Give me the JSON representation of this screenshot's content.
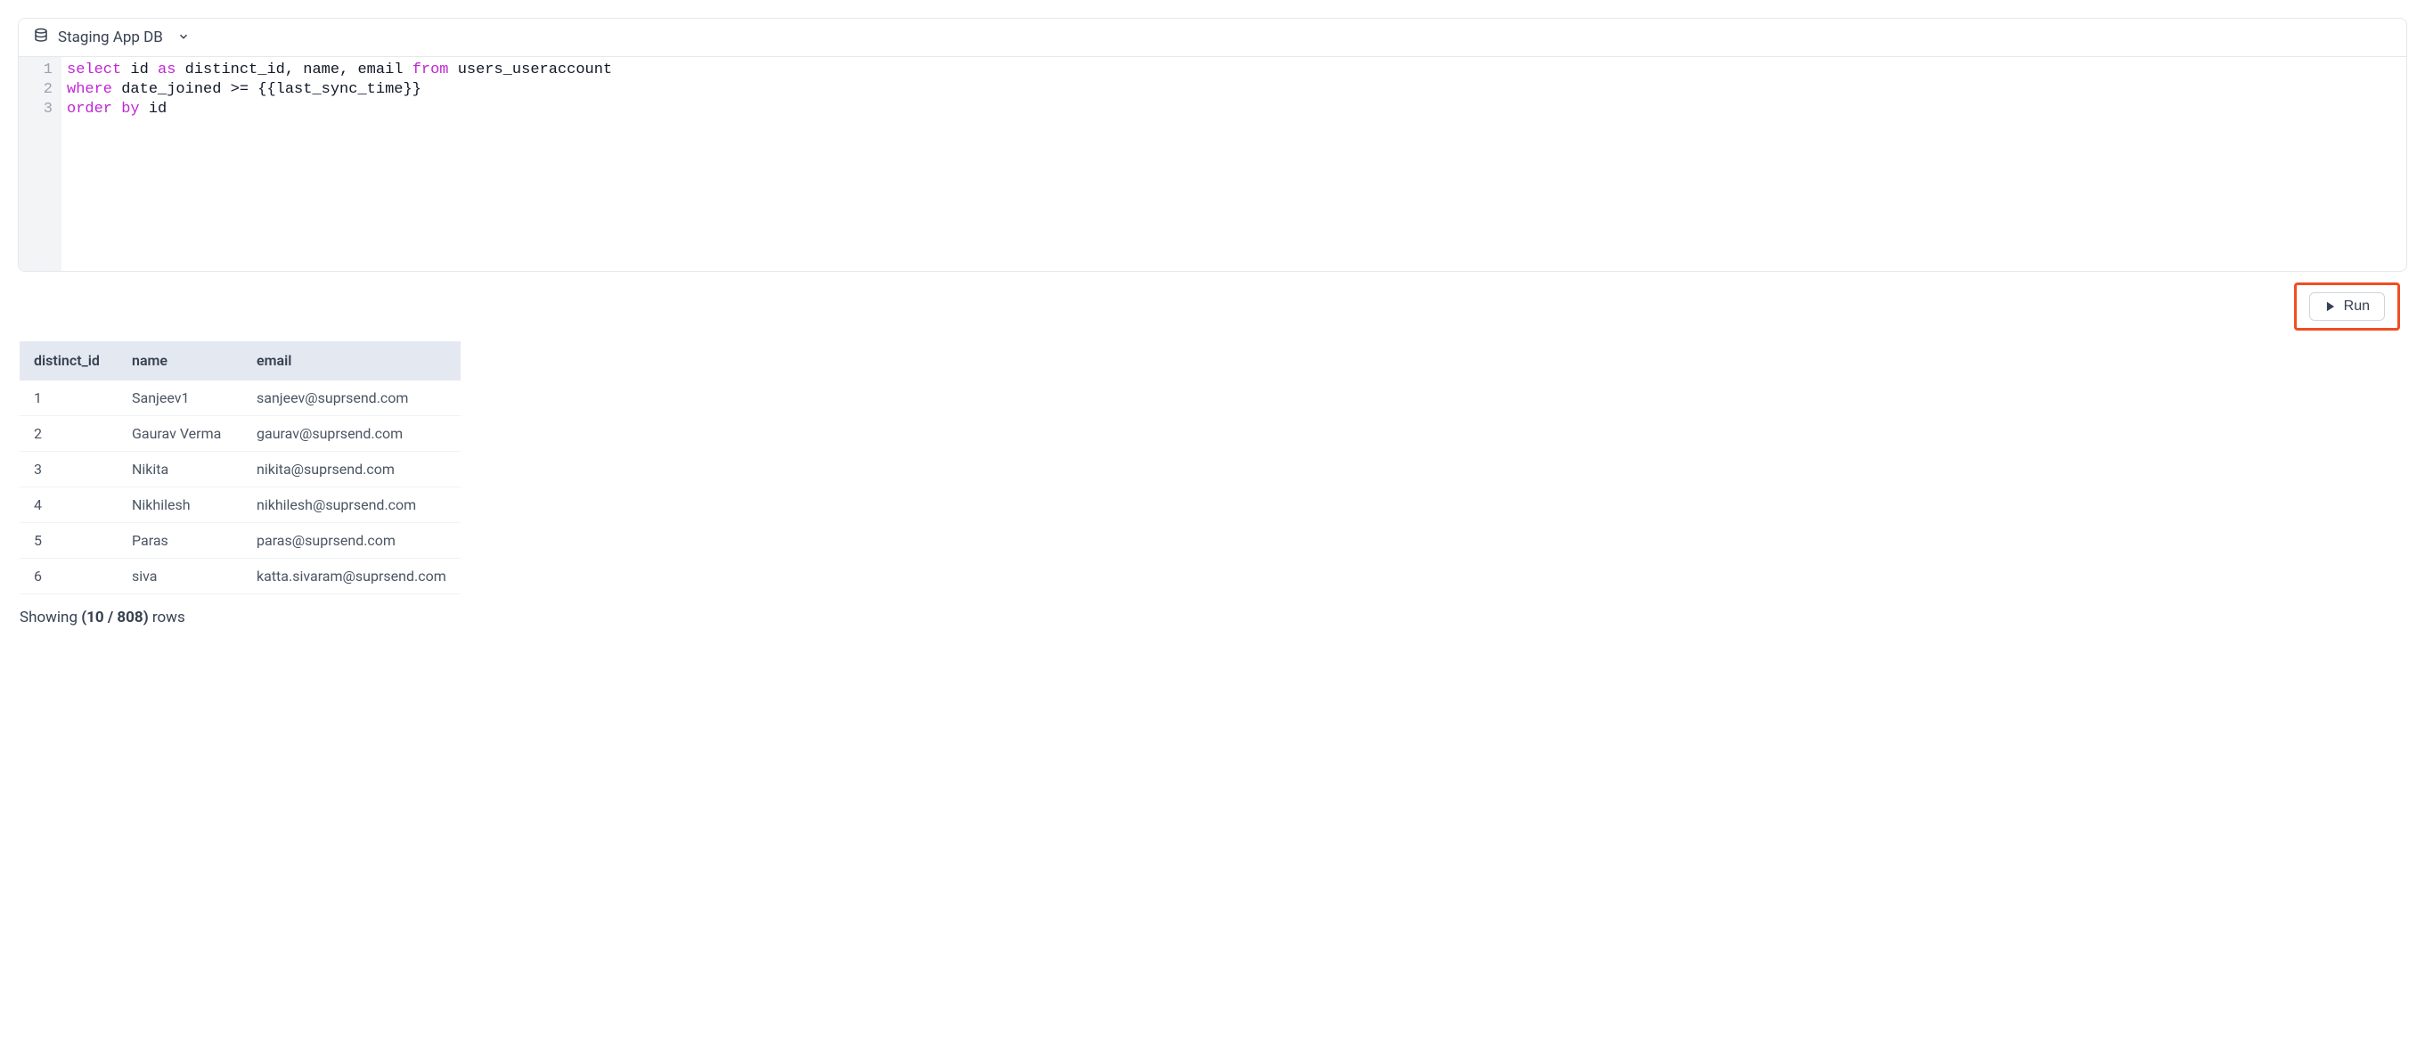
{
  "db_selector": {
    "name": "Staging App DB"
  },
  "editor": {
    "lines": [
      {
        "num": "1",
        "tokens": [
          {
            "t": "select",
            "c": "kw"
          },
          {
            "t": " id ",
            "c": "txt"
          },
          {
            "t": "as",
            "c": "kw"
          },
          {
            "t": " distinct_id, name, email ",
            "c": "txt"
          },
          {
            "t": "from",
            "c": "kw"
          },
          {
            "t": " users_useraccount",
            "c": "txt"
          }
        ]
      },
      {
        "num": "2",
        "tokens": [
          {
            "t": "where",
            "c": "kw"
          },
          {
            "t": " date_joined >= {{last_sync_time}}",
            "c": "txt"
          }
        ]
      },
      {
        "num": "3",
        "tokens": [
          {
            "t": "order by",
            "c": "kw"
          },
          {
            "t": " id",
            "c": "txt"
          }
        ]
      }
    ]
  },
  "run_button": {
    "label": "Run"
  },
  "results": {
    "columns": [
      "distinct_id",
      "name",
      "email"
    ],
    "rows": [
      {
        "distinct_id": "1",
        "name": "Sanjeev1",
        "email": "sanjeev@suprsend.com"
      },
      {
        "distinct_id": "2",
        "name": "Gaurav Verma",
        "email": "gaurav@suprsend.com"
      },
      {
        "distinct_id": "3",
        "name": "Nikita",
        "email": "nikita@suprsend.com"
      },
      {
        "distinct_id": "4",
        "name": "Nikhilesh",
        "email": "nikhilesh@suprsend.com"
      },
      {
        "distinct_id": "5",
        "name": "Paras",
        "email": "paras@suprsend.com"
      },
      {
        "distinct_id": "6",
        "name": "siva",
        "email": "katta.sivaram@suprsend.com"
      }
    ]
  },
  "footer": {
    "prefix": "Showing ",
    "count": "(10 / 808)",
    "suffix": " rows"
  }
}
